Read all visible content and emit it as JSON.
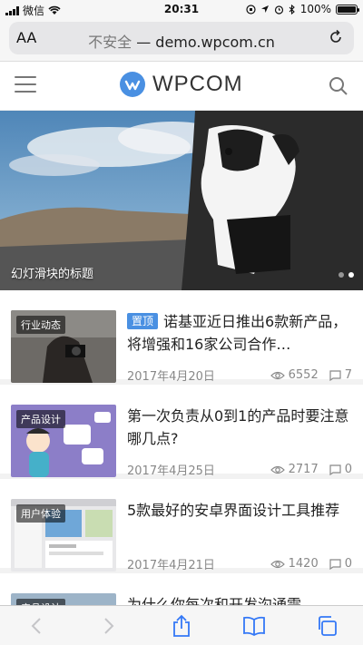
{
  "status": {
    "carrier": "微信",
    "time": "20:31",
    "battery": "100%",
    "battery_level": 1.0
  },
  "browser": {
    "aa_label": "AA",
    "insecure": "不安全",
    "separator": " — ",
    "domain": "demo.wpcom.cn"
  },
  "header": {
    "logo_text": "WPCOM"
  },
  "slider": {
    "title": "幻灯滑块的标题",
    "dots": 2,
    "active_dot": 1
  },
  "posts": [
    {
      "category": "行业动态",
      "pinned": true,
      "pin_label": "置顶",
      "title": "诺基亚近日推出6款新产品，将增强和16家公司合作…",
      "date": "2017年4月20日",
      "views": "6552",
      "comments": "7"
    },
    {
      "category": "产品设计",
      "pinned": false,
      "title": "第一次负责从0到1的产品时要注意哪几点?",
      "date": "2017年4月25日",
      "views": "2717",
      "comments": "0"
    },
    {
      "category": "用户体验",
      "pinned": false,
      "title": "5款最好的安卓界面设计工具推荐",
      "date": "2017年4月21日",
      "views": "1420",
      "comments": "0"
    },
    {
      "category": "产品设计",
      "pinned": false,
      "title": "为什么你每次和开发沟通需",
      "date": "",
      "views": "",
      "comments": ""
    }
  ],
  "colors": {
    "accent": "#4a90e2"
  }
}
